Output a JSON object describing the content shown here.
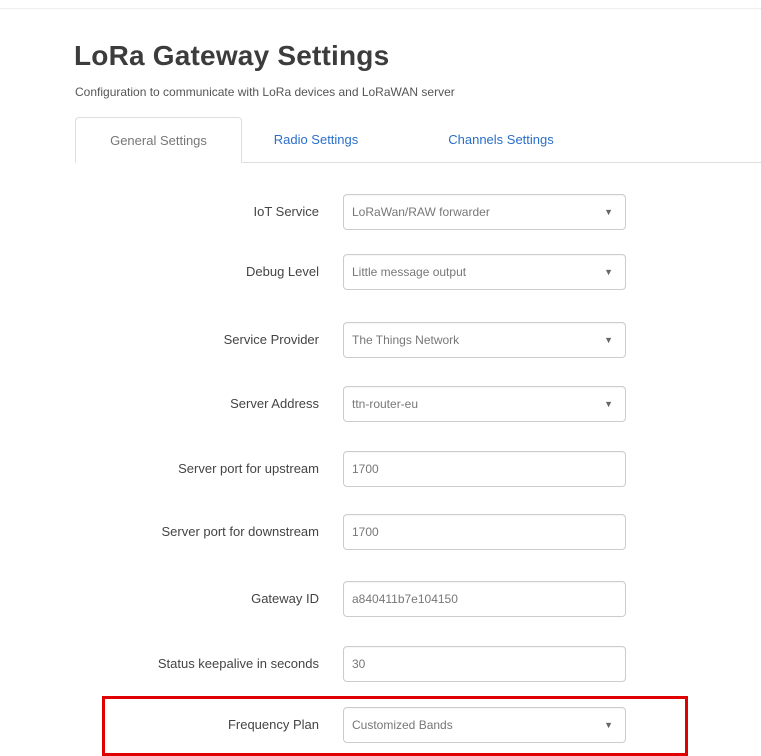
{
  "page": {
    "title": "LoRa Gateway Settings",
    "description": "Configuration to communicate with LoRa devices and LoRaWAN server"
  },
  "tabs": [
    {
      "label": "General Settings",
      "active": true
    },
    {
      "label": "Radio Settings",
      "active": false
    },
    {
      "label": "Channels Settings",
      "active": false
    }
  ],
  "form": {
    "iot_service": {
      "label": "IoT Service",
      "value": "LoRaWan/RAW forwarder",
      "icon": "chevron-down-icon"
    },
    "debug_level": {
      "label": "Debug Level",
      "value": "Little message output",
      "icon": "chevron-down-icon"
    },
    "service_provider": {
      "label": "Service Provider",
      "value": "The Things Network",
      "icon": "chevron-down-icon"
    },
    "server_address": {
      "label": "Server Address",
      "value": "ttn-router-eu",
      "icon": "chevron-down-icon"
    },
    "upstream_port": {
      "label": "Server port for upstream",
      "value": "1700"
    },
    "downstream_port": {
      "label": "Server port for downstream",
      "value": "1700"
    },
    "gateway_id": {
      "label": "Gateway ID",
      "value": "a840411b7e104150"
    },
    "keepalive": {
      "label": "Status keepalive in seconds",
      "value": "30"
    },
    "frequency_plan": {
      "label": "Frequency Plan",
      "value": "Customized Bands",
      "icon": "chevron-down-icon"
    }
  },
  "colors": {
    "link": "#2a6fc9",
    "highlight": "#e00000"
  }
}
